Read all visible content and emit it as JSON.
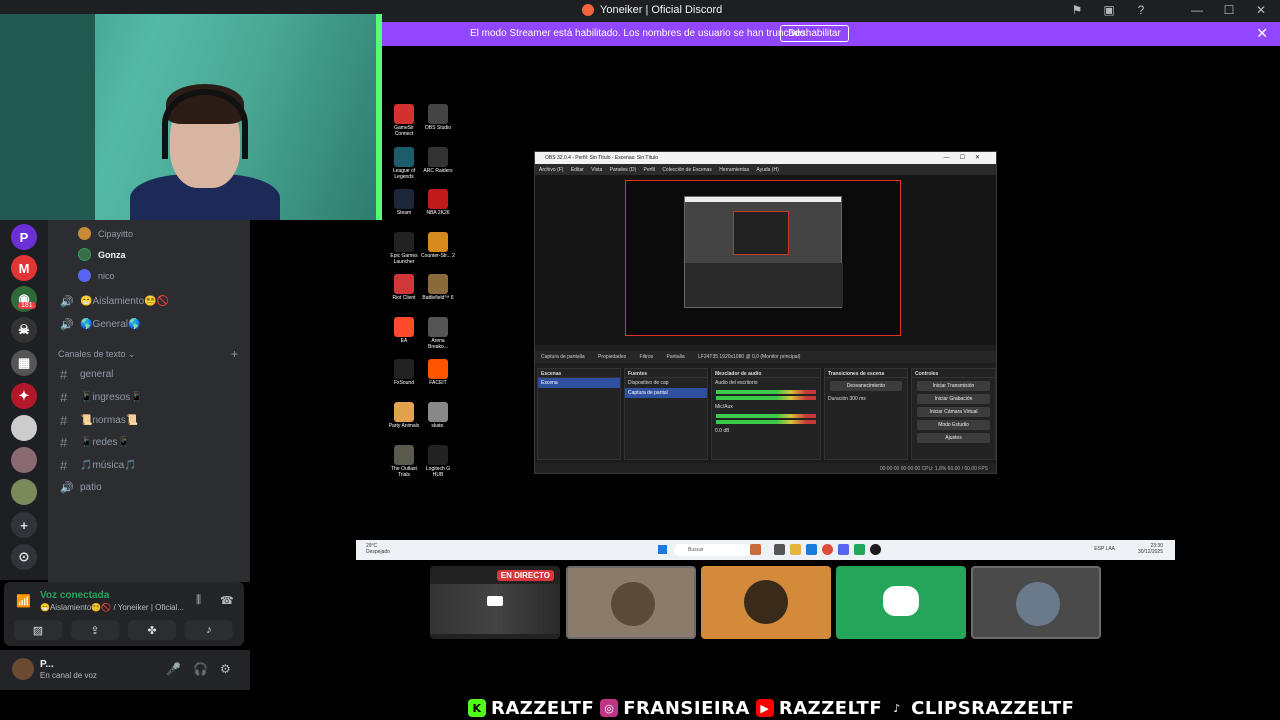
{
  "window": {
    "title": "Yoneiker | Oficial Discord"
  },
  "banner": {
    "message": "El modo Streamer está habilitado. Los nombres de usuario se han truncado.",
    "button_label": "Deshabilitar"
  },
  "servers": {
    "badge": "181"
  },
  "voice_users": [
    {
      "name": "Cipayitto"
    },
    {
      "name": "Gonza"
    },
    {
      "name": "nico"
    }
  ],
  "voice_channels": [
    {
      "name": "😁Aislamiento😵‍💫🚫"
    },
    {
      "name": "🌎General🌎"
    }
  ],
  "text_category": "Canales de texto",
  "text_channels": [
    {
      "name": "general"
    },
    {
      "name": "📱ingresos📱"
    },
    {
      "name": "📜normas📜"
    },
    {
      "name": "📱redes📱"
    },
    {
      "name": "🎵música🎵"
    },
    {
      "name": "patio"
    }
  ],
  "voice_panel": {
    "status": "Voz conectada",
    "subtitle": "😁Aislamiento😵‍💫🚫 / Yoneiker | Oficial..."
  },
  "user_panel": {
    "name": "P...",
    "status": "En canal de voz"
  },
  "desktop_icons": [
    {
      "label": "GameSir Connect",
      "color": "#d33030"
    },
    {
      "label": "OBS Studio",
      "color": "#444444"
    },
    {
      "label": "League of Legends",
      "color": "#1d5d6b"
    },
    {
      "label": "ARC Raiders",
      "color": "#333333"
    },
    {
      "label": "Steam",
      "color": "#1b2838"
    },
    {
      "label": "NBA 2K26",
      "color": "#c01a1a"
    },
    {
      "label": "Epic Games Launcher",
      "color": "#222222"
    },
    {
      "label": "Counter-Str... 2",
      "color": "#d68a1e"
    },
    {
      "label": "Riot Client",
      "color": "#d13639"
    },
    {
      "label": "Battlefield™ 6",
      "color": "#8a6a3a"
    },
    {
      "label": "EA",
      "color": "#ff4b2b"
    },
    {
      "label": "Arena Breako...",
      "color": "#555555"
    },
    {
      "label": "FxSound",
      "color": "#222222"
    },
    {
      "label": "FACEIT",
      "color": "#ff5500"
    },
    {
      "label": "Party Animals",
      "color": "#e0a24a"
    },
    {
      "label": "skate.",
      "color": "#888888"
    },
    {
      "label": "The Outlast Trials",
      "color": "#5a5a4a"
    },
    {
      "label": "Logitech G HUB",
      "color": "#222222"
    }
  ],
  "obs": {
    "title": "OBS 32.0.4 - Perfil: Sin Título - Escenas: Sin Título",
    "menu": [
      "Archivo (F)",
      "Editar",
      "Vista",
      "Paneles (D)",
      "Perfil",
      "Colección de Escenas",
      "Herramientas",
      "Ayuda (H)"
    ],
    "source_bar": [
      "Captura de pantalla",
      "Propiedades",
      "Filtros",
      "Pantalla",
      "LF24T35 1920x1080 @ 0,0 (Monitor principal)"
    ],
    "docks": {
      "scenes": {
        "title": "Escenas",
        "items": [
          "Escena"
        ]
      },
      "sources": {
        "title": "Fuentes",
        "items": [
          "Dispositivo de cap",
          "Captura de pantal"
        ]
      },
      "mixer": {
        "title": "Mezclador de audio",
        "items": [
          "Audio del escritorio",
          "Mic/Aux"
        ],
        "level": "0.0 dB"
      },
      "transitions": {
        "title": "Transiciones de escena",
        "type": "Desvanecimiento",
        "duration_label": "Duración",
        "duration": "300 ms"
      },
      "controls": {
        "title": "Controles",
        "buttons": [
          "Iniciar Transmisión",
          "Iniciar Grabación",
          "Iniciar Cámara Virtual",
          "Modo Estudio",
          "Ajustes"
        ]
      }
    },
    "status": "00:00:00   00:00:00   CPU: 1.8%   60.00 / 60.00 FPS"
  },
  "taskbar": {
    "weather": [
      "29°C",
      "Despejado"
    ],
    "search_placeholder": "Buscar",
    "clock": [
      "23:30",
      "30/12/2025"
    ],
    "lang": "ESP LAA"
  },
  "live_badge": "EN DIRECTO",
  "socials": [
    {
      "handle": "RAZZELTF",
      "icon": "kick-icon",
      "color": "#53fc18"
    },
    {
      "handle": "FRANSIEIRA",
      "icon": "instagram-icon",
      "color": "#c13584"
    },
    {
      "handle": "RAZZELTF",
      "icon": "youtube-icon",
      "color": "#ff0000"
    },
    {
      "handle": "CLIPSRAZZELTF",
      "icon": "tiktok-icon",
      "color": "#000000"
    }
  ]
}
